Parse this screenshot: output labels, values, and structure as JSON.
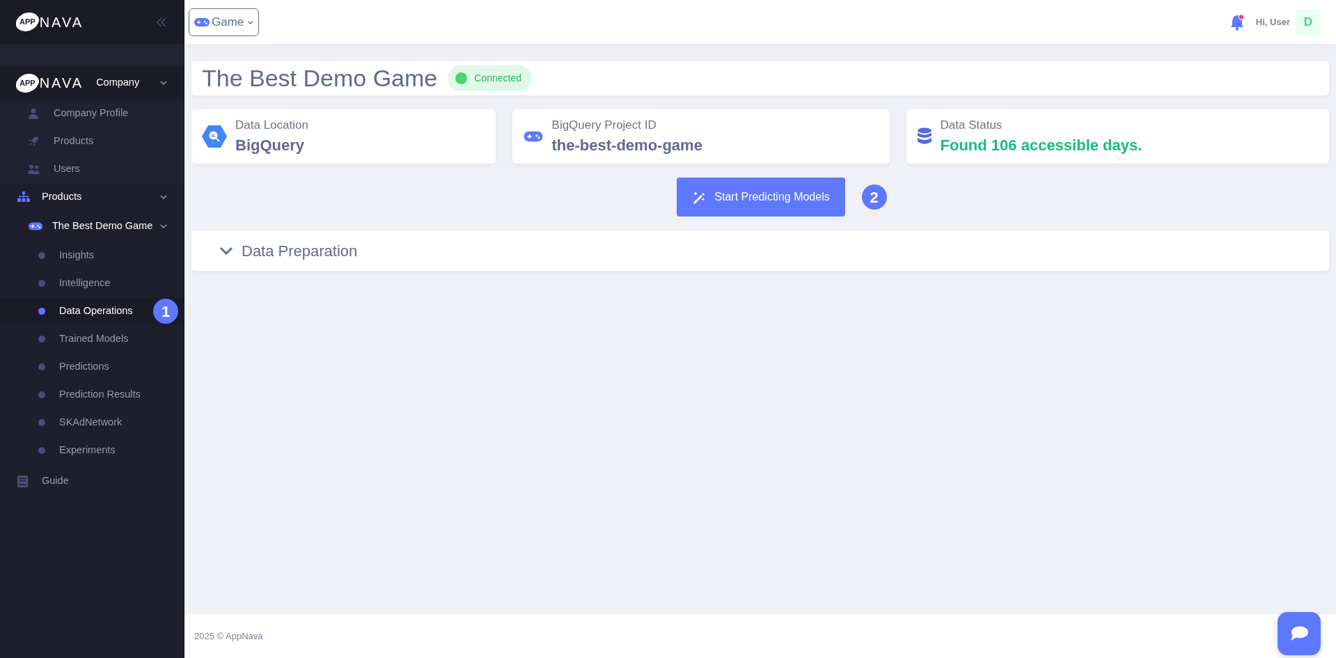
{
  "sidebar": {
    "logo": {
      "badge": "APP",
      "word": "NAVA"
    },
    "company": {
      "logo": {
        "badge": "APP",
        "word": "NAVA"
      },
      "label": "Company",
      "expanded": true,
      "items": [
        {
          "label": "Company Profile"
        },
        {
          "label": "Products"
        },
        {
          "label": "Users"
        }
      ]
    },
    "products": {
      "label": "Products",
      "expanded": true,
      "children": [
        {
          "label": "The Best Demo Game",
          "expanded": true,
          "children": [
            {
              "label": "Insights",
              "selected": false
            },
            {
              "label": "Intelligence",
              "selected": false
            },
            {
              "label": "Data Operations",
              "selected": true,
              "marker": "1"
            },
            {
              "label": "Trained Models",
              "selected": false
            },
            {
              "label": "Predictions",
              "selected": false
            },
            {
              "label": "Prediction Results",
              "selected": false
            },
            {
              "label": "SKAdNetwork",
              "selected": false
            },
            {
              "label": "Experiments",
              "selected": false
            }
          ]
        }
      ]
    },
    "guide": {
      "label": "Guide"
    }
  },
  "header": {
    "selector": "Game",
    "notification_unread": true,
    "greeting": "Hi, User",
    "avatar": "D"
  },
  "page": {
    "title": "The Best Demo Game",
    "status": "Connected",
    "cards": [
      {
        "kind": "location",
        "label": "Data Location",
        "value": "BigQuery"
      },
      {
        "kind": "project",
        "label": "BigQuery Project ID",
        "value": "the-best-demo-game"
      },
      {
        "kind": "status",
        "label": "Data Status",
        "value": "Found 106 accessible days."
      }
    ],
    "action": {
      "label": "Start Predicting Models",
      "marker": "2"
    },
    "section": {
      "label": "Data Preparation"
    }
  },
  "footer": {
    "text": "2025 © AppNava"
  }
}
